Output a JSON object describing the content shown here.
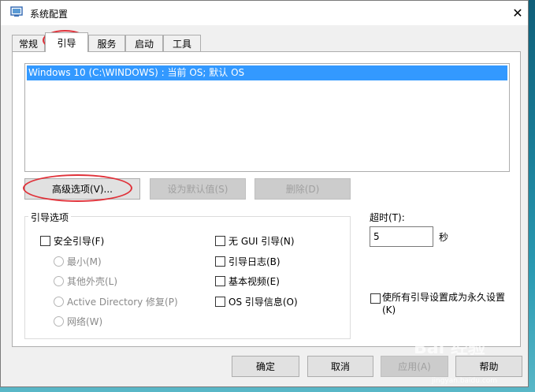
{
  "window": {
    "title": "系统配置",
    "close_symbol": "✕"
  },
  "tabs": [
    {
      "label": "常规"
    },
    {
      "label": "引导"
    },
    {
      "label": "服务"
    },
    {
      "label": "启动"
    },
    {
      "label": "工具"
    }
  ],
  "boot_list": {
    "entries": [
      "Windows 10 (C:\\WINDOWS) : 当前 OS; 默认 OS"
    ]
  },
  "buttons": {
    "advanced": "高级选项(V)...",
    "set_default": "设为默认值(S)",
    "delete": "删除(D)"
  },
  "boot_options": {
    "group_title": "引导选项",
    "safe_boot": "安全引导(F)",
    "minimal": "最小(M)",
    "alternate_shell": "其他外壳(L)",
    "active_directory_repair": "Active Directory 修复(P)",
    "network": "网络(W)",
    "no_gui": "无 GUI 引导(N)",
    "boot_log": "引导日志(B)",
    "base_video": "基本视频(E)",
    "os_boot_info": "OS 引导信息(O)"
  },
  "timeout": {
    "label": "超时(T):",
    "value": "5",
    "unit": "秒"
  },
  "permanent": {
    "label": "使所有引导设置成为永久设置(K)"
  },
  "footer": {
    "ok": "确定",
    "cancel": "取消",
    "apply": "应用(A)",
    "help": "帮助"
  },
  "watermark": {
    "text": "Bai 经验",
    "url": "jingyan.baidu.com"
  },
  "colors": {
    "selection": "#3399ff",
    "annotation": "#e0323a"
  }
}
